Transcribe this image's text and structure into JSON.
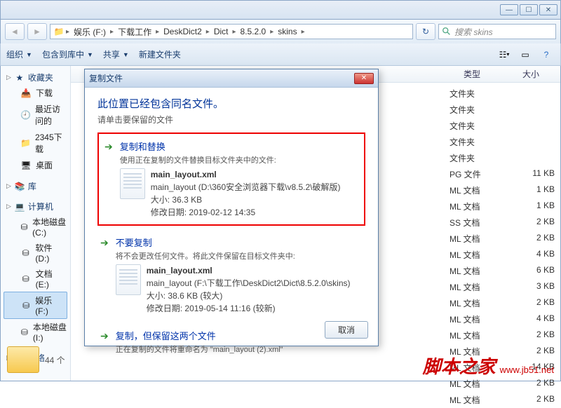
{
  "breadcrumb": [
    "娱乐 (F:)",
    "下载工作",
    "DeskDict2",
    "Dict",
    "8.5.2.0",
    "skins"
  ],
  "search_placeholder": "搜索 skins",
  "toolbar": {
    "organize": "组织",
    "include": "包含到库中",
    "share": "共享",
    "newfolder": "新建文件夹"
  },
  "sidebar": {
    "favorites": "收藏夹",
    "fav_items": [
      "下载",
      "最近访问的",
      "2345下载",
      "桌面"
    ],
    "libraries": "库",
    "computer": "计算机",
    "drives": [
      "本地磁盘 (C:)",
      "软件 (D:)",
      "文档 (E:)",
      "娱乐 (F:)",
      "本地磁盘 (I:)"
    ],
    "network": "网络"
  },
  "preview_count": "44 个",
  "columns": {
    "type": "类型",
    "size": "大小"
  },
  "rows": [
    {
      "type": "文件夹",
      "size": ""
    },
    {
      "type": "文件夹",
      "size": ""
    },
    {
      "type": "文件夹",
      "size": ""
    },
    {
      "type": "文件夹",
      "size": ""
    },
    {
      "type": "文件夹",
      "size": ""
    },
    {
      "type": "PG 文件",
      "size": "11 KB"
    },
    {
      "type": "ML 文档",
      "size": "1 KB"
    },
    {
      "type": "ML 文档",
      "size": "1 KB"
    },
    {
      "type": "SS 文档",
      "size": "2 KB"
    },
    {
      "type": "ML 文档",
      "size": "2 KB"
    },
    {
      "type": "ML 文档",
      "size": "4 KB"
    },
    {
      "type": "ML 文档",
      "size": "6 KB"
    },
    {
      "type": "ML 文档",
      "size": "3 KB"
    },
    {
      "type": "ML 文档",
      "size": "2 KB"
    },
    {
      "type": "ML 文档",
      "size": "4 KB"
    },
    {
      "type": "ML 文档",
      "size": "2 KB"
    },
    {
      "type": "ML 文档",
      "size": "2 KB"
    },
    {
      "type": "ML 文档",
      "size": "14 KB"
    },
    {
      "type": "ML 文档",
      "size": "2 KB"
    },
    {
      "type": "ML 文档",
      "size": "2 KB"
    }
  ],
  "dialog": {
    "title": "复制文件",
    "heading": "此位置已经包含同名文件。",
    "subheading": "请单击要保留的文件",
    "opt1": {
      "title": "复制和替换",
      "desc": "使用正在复制的文件替换目标文件夹中的文件:",
      "file_name": "main_layout.xml",
      "file_path": "main_layout (D:\\360安全浏览器下载\\v8.5.2\\破解版)",
      "size": "大小: 36.3 KB",
      "date": "修改日期: 2019-02-12 14:35"
    },
    "opt2": {
      "title": "不要复制",
      "desc": "将不会更改任何文件。将此文件保留在目标文件夹中:",
      "file_name": "main_layout.xml",
      "file_path": "main_layout (F:\\下载工作\\DeskDict2\\Dict\\8.5.2.0\\skins)",
      "size": "大小: 38.6 KB (较大)",
      "date": "修改日期: 2019-05-14 11:16 (较新)"
    },
    "opt3": {
      "title": "复制，但保留这两个文件",
      "desc": "正在复制的文件将重命名为 \"main_layout (2).xml\""
    },
    "cancel": "取消"
  },
  "watermark": {
    "cn": "脚本之家",
    "url": "www.jb51.net"
  }
}
